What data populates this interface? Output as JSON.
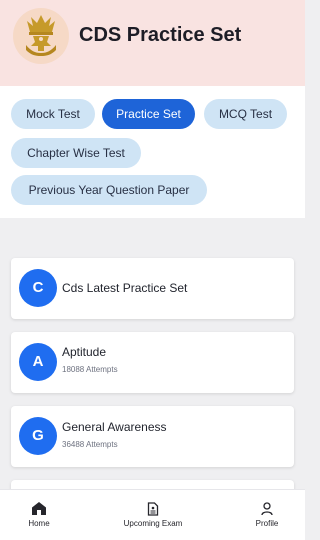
{
  "header": {
    "title": "CDS Practice Set",
    "logo_icon": "army-emblem-icon",
    "background": "#f9e3e1"
  },
  "tabs": [
    {
      "label": "Mock Test",
      "active": false
    },
    {
      "label": "Practice Set",
      "active": true
    },
    {
      "label": "MCQ Test",
      "active": false
    },
    {
      "label": "Chapter Wise Test",
      "active": false
    },
    {
      "label": "Previous Year Question Paper",
      "active": false
    }
  ],
  "cards": [
    {
      "initial": "C",
      "title": "Cds Latest Practice Set",
      "subtitle": ""
    },
    {
      "initial": "A",
      "title": "Aptitude",
      "subtitle": "18088 Attempts"
    },
    {
      "initial": "G",
      "title": "General Awareness",
      "subtitle": "36488 Attempts"
    }
  ],
  "bottom_nav": [
    {
      "label": "Home",
      "icon": "home-icon"
    },
    {
      "label": "Upcoming Exam",
      "icon": "exam-document-icon"
    },
    {
      "label": "Profile",
      "icon": "profile-icon"
    }
  ],
  "colors": {
    "accent": "#1e64d8",
    "chip": "#cfe4f5",
    "avatar": "#1f6df0"
  }
}
